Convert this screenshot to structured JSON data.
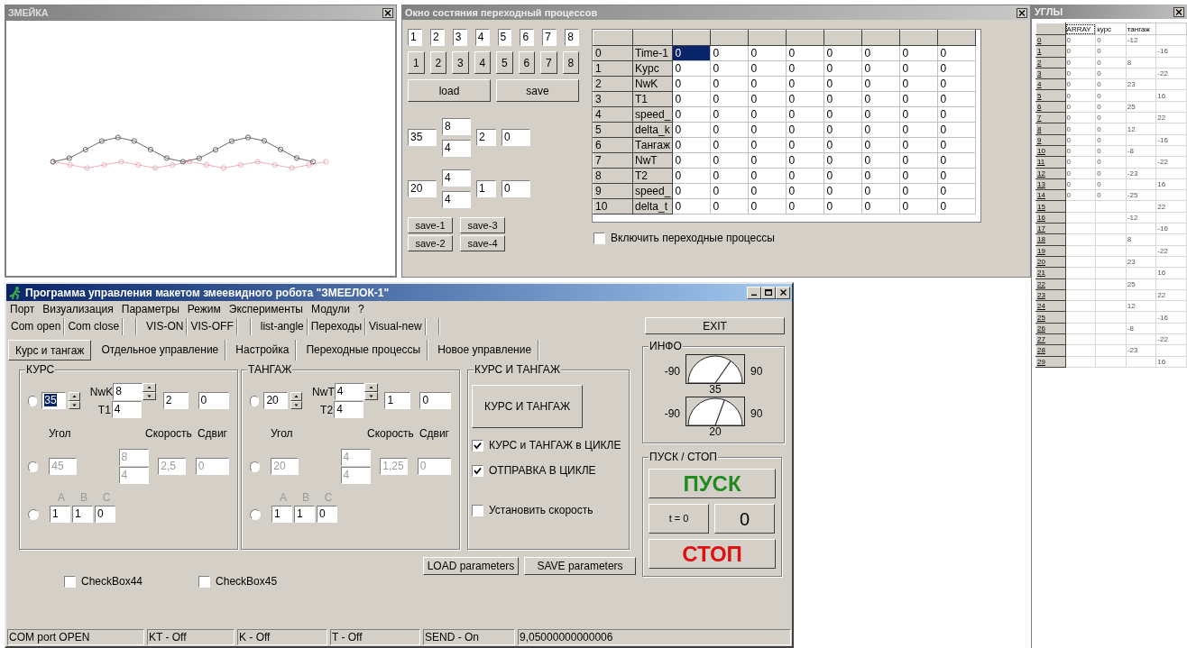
{
  "graph_window": {
    "title": "ЗМЕЙКА"
  },
  "transition_window": {
    "title": "Окно состяния переходный процессов",
    "index_fields": [
      "1",
      "2",
      "3",
      "4",
      "5",
      "6",
      "7",
      "8"
    ],
    "index_buttons": [
      "1",
      "2",
      "3",
      "4",
      "5",
      "6",
      "7",
      "8"
    ],
    "file_buttons": [
      "load",
      "save"
    ],
    "parameter_sets": [
      {
        "angle": "35",
        "nw": "8",
        "t": "4",
        "speed": "2",
        "shift": "0"
      },
      {
        "angle": "20",
        "nw": "4",
        "t": "4",
        "speed": "1",
        "shift": "0"
      }
    ],
    "save_buttons": [
      "save-1",
      "save-3",
      "save-2",
      "save-4"
    ],
    "table": {
      "rows": [
        {
          "index": "0",
          "name": "Time-1",
          "cells": [
            {
              "value": "0",
              "selected": true
            },
            {
              "value": "0",
              "selected": false
            },
            {
              "value": "0",
              "selected": false
            },
            {
              "value": "0",
              "selected": false
            },
            {
              "value": "0",
              "selected": false
            },
            {
              "value": "0",
              "selected": false
            },
            {
              "value": "0",
              "selected": false
            },
            {
              "value": "0",
              "selected": false
            }
          ]
        },
        {
          "index": "1",
          "name": "Kypc",
          "cells": [
            {
              "value": "0",
              "selected": false
            },
            {
              "value": "0",
              "selected": false
            },
            {
              "value": "0",
              "selected": false
            },
            {
              "value": "0",
              "selected": false
            },
            {
              "value": "0",
              "selected": false
            },
            {
              "value": "0",
              "selected": false
            },
            {
              "value": "0",
              "selected": false
            },
            {
              "value": "0",
              "selected": false
            }
          ]
        },
        {
          "index": "2",
          "name": "NwK",
          "cells": [
            {
              "value": "0",
              "selected": false
            },
            {
              "value": "0",
              "selected": false
            },
            {
              "value": "0",
              "selected": false
            },
            {
              "value": "0",
              "selected": false
            },
            {
              "value": "0",
              "selected": false
            },
            {
              "value": "0",
              "selected": false
            },
            {
              "value": "0",
              "selected": false
            },
            {
              "value": "0",
              "selected": false
            }
          ]
        },
        {
          "index": "3",
          "name": "T1",
          "cells": [
            {
              "value": "0",
              "selected": false
            },
            {
              "value": "0",
              "selected": false
            },
            {
              "value": "0",
              "selected": false
            },
            {
              "value": "0",
              "selected": false
            },
            {
              "value": "0",
              "selected": false
            },
            {
              "value": "0",
              "selected": false
            },
            {
              "value": "0",
              "selected": false
            },
            {
              "value": "0",
              "selected": false
            }
          ]
        },
        {
          "index": "4",
          "name": "speed_",
          "cells": [
            {
              "value": "0",
              "selected": false
            },
            {
              "value": "0",
              "selected": false
            },
            {
              "value": "0",
              "selected": false
            },
            {
              "value": "0",
              "selected": false
            },
            {
              "value": "0",
              "selected": false
            },
            {
              "value": "0",
              "selected": false
            },
            {
              "value": "0",
              "selected": false
            },
            {
              "value": "0",
              "selected": false
            }
          ]
        },
        {
          "index": "5",
          "name": "delta_k",
          "cells": [
            {
              "value": "0",
              "selected": false
            },
            {
              "value": "0",
              "selected": false
            },
            {
              "value": "0",
              "selected": false
            },
            {
              "value": "0",
              "selected": false
            },
            {
              "value": "0",
              "selected": false
            },
            {
              "value": "0",
              "selected": false
            },
            {
              "value": "0",
              "selected": false
            },
            {
              "value": "0",
              "selected": false
            }
          ]
        },
        {
          "index": "6",
          "name": "Тангаж",
          "cells": [
            {
              "value": "0",
              "selected": false
            },
            {
              "value": "0",
              "selected": false
            },
            {
              "value": "0",
              "selected": false
            },
            {
              "value": "0",
              "selected": false
            },
            {
              "value": "0",
              "selected": false
            },
            {
              "value": "0",
              "selected": false
            },
            {
              "value": "0",
              "selected": false
            },
            {
              "value": "0",
              "selected": false
            }
          ]
        },
        {
          "index": "7",
          "name": "NwT",
          "cells": [
            {
              "value": "0",
              "selected": false
            },
            {
              "value": "0",
              "selected": false
            },
            {
              "value": "0",
              "selected": false
            },
            {
              "value": "0",
              "selected": false
            },
            {
              "value": "0",
              "selected": false
            },
            {
              "value": "0",
              "selected": false
            },
            {
              "value": "0",
              "selected": false
            },
            {
              "value": "0",
              "selected": false
            }
          ]
        },
        {
          "index": "8",
          "name": "T2",
          "cells": [
            {
              "value": "0",
              "selected": false
            },
            {
              "value": "0",
              "selected": false
            },
            {
              "value": "0",
              "selected": false
            },
            {
              "value": "0",
              "selected": false
            },
            {
              "value": "0",
              "selected": false
            },
            {
              "value": "0",
              "selected": false
            },
            {
              "value": "0",
              "selected": false
            },
            {
              "value": "0",
              "selected": false
            }
          ]
        },
        {
          "index": "9",
          "name": "speed_",
          "cells": [
            {
              "value": "0",
              "selected": false
            },
            {
              "value": "0",
              "selected": false
            },
            {
              "value": "0",
              "selected": false
            },
            {
              "value": "0",
              "selected": false
            },
            {
              "value": "0",
              "selected": false
            },
            {
              "value": "0",
              "selected": false
            },
            {
              "value": "0",
              "selected": false
            },
            {
              "value": "0",
              "selected": false
            }
          ]
        },
        {
          "index": "10",
          "name": "delta_t",
          "cells": [
            {
              "value": "0",
              "selected": false
            },
            {
              "value": "0",
              "selected": false
            },
            {
              "value": "0",
              "selected": false
            },
            {
              "value": "0",
              "selected": false
            },
            {
              "value": "0",
              "selected": false
            },
            {
              "value": "0",
              "selected": false
            },
            {
              "value": "0",
              "selected": false
            },
            {
              "value": "0",
              "selected": false
            }
          ]
        }
      ]
    },
    "enable_checkbox": {
      "label": "Включить переходные процессы",
      "checked": false
    }
  },
  "angles_window": {
    "title": "УГЛЫ",
    "columns": [
      "ARRAY",
      "курс",
      "тангаж"
    ],
    "rows": [
      {
        "index": "0",
        "array": "0",
        "kurs": "0",
        "tangazh": "-12"
      },
      {
        "index": "1",
        "array": "0",
        "kurs": "0",
        "column_4": "-16"
      },
      {
        "index": "2",
        "array": "0",
        "kurs": "0",
        "tangazh": "8"
      },
      {
        "index": "3",
        "array": "0",
        "kurs": "0",
        "column_4": "-22"
      },
      {
        "index": "4",
        "array": "0",
        "kurs": "0",
        "tangazh": "23"
      },
      {
        "index": "5",
        "array": "0",
        "kurs": "0",
        "column_4": "16"
      },
      {
        "index": "6",
        "array": "0",
        "kurs": "0",
        "tangazh": "25"
      },
      {
        "index": "7",
        "array": "0",
        "kurs": "0",
        "column_4": "22"
      },
      {
        "index": "8",
        "array": "0",
        "kurs": "0",
        "tangazh": "12"
      },
      {
        "index": "9",
        "array": "0",
        "kurs": "0",
        "column_4": "-16"
      },
      {
        "index": "10",
        "array": "0",
        "kurs": "0",
        "tangazh": "-8"
      },
      {
        "index": "11",
        "array": "0",
        "kurs": "0",
        "column_4": "-22"
      },
      {
        "index": "12",
        "array": "0",
        "kurs": "0",
        "tangazh": "-23"
      },
      {
        "index": "13",
        "array": "0",
        "kurs": "0",
        "column_4": "16"
      },
      {
        "index": "14",
        "array": "0",
        "kurs": "0",
        "tangazh": "-25"
      },
      {
        "index": "15",
        "column_4": "22"
      },
      {
        "index": "16",
        "tangazh": "-12"
      },
      {
        "index": "17",
        "column_4": "-16"
      },
      {
        "index": "18",
        "tangazh": "8"
      },
      {
        "index": "19",
        "column_4": "-22"
      },
      {
        "index": "20",
        "tangazh": "23"
      },
      {
        "index": "21",
        "column_4": "16"
      },
      {
        "index": "22",
        "tangazh": "25"
      },
      {
        "index": "23",
        "column_4": "22"
      },
      {
        "index": "24",
        "tangazh": "12"
      },
      {
        "index": "25",
        "column_4": "-16"
      },
      {
        "index": "26",
        "tangazh": "-8"
      },
      {
        "index": "27",
        "column_4": "-22"
      },
      {
        "index": "28",
        "tangazh": "-23"
      },
      {
        "index": "29",
        "column_4": "16"
      }
    ]
  },
  "main_window": {
    "title": "Программа управления макетом змеевидного робота \"ЗМЕЕЛОК-1\"",
    "menu": [
      "Порт",
      "Визуализация",
      "Параметры",
      "Режим",
      "Эксперименты",
      "Модули",
      "?"
    ],
    "toolbar": [
      {
        "kind": "button",
        "label": "Com open"
      },
      {
        "kind": "button",
        "label": "Com close"
      },
      {
        "kind": "spacer"
      },
      {
        "kind": "button",
        "label": "VIS-ON"
      },
      {
        "kind": "button",
        "label": "VIS-OFF"
      },
      {
        "kind": "spacer"
      },
      {
        "kind": "button",
        "label": "list-angle"
      },
      {
        "kind": "button",
        "label": "Переходы"
      },
      {
        "kind": "button",
        "label": "Visual-new"
      },
      {
        "kind": "spacer"
      }
    ],
    "exit_button": "EXIT",
    "tabs": [
      {
        "label": "Курс и тангаж",
        "selected": true
      },
      {
        "label": "Отдельное управление",
        "selected": false
      },
      {
        "label": "Настройка",
        "selected": false
      },
      {
        "label": "Переходные процессы",
        "selected": false
      },
      {
        "label": "Новое управление",
        "selected": false
      }
    ],
    "groups": [
      {
        "title": "КУРС",
        "angle": "35",
        "angle_focused": true,
        "nw_label": "NwK",
        "nw": "8",
        "t_label": "T1",
        "t": "4",
        "speed": "2",
        "shift": "0",
        "angle_label": "Угол",
        "speed_label": "Скорость",
        "shift_label": "Сдвиг",
        "radios": [
          {
            "selected": false
          },
          {
            "selected": false
          },
          {
            "selected": false
          }
        ],
        "preset": {
          "angle": "45",
          "nw": "8",
          "t": "4",
          "speed": "2,5",
          "shift": "0",
          "disabled": true
        },
        "abc_labels": [
          "A",
          "B",
          "C"
        ],
        "abc": [
          "1",
          "1",
          "0"
        ]
      },
      {
        "title": "ТАНГАЖ",
        "angle": "20",
        "angle_focused": false,
        "nw_label": "NwT",
        "nw": "4",
        "t_label": "T2",
        "t": "4",
        "speed": "1",
        "shift": "0",
        "angle_label": "Угол",
        "speed_label": "Скорость",
        "shift_label": "Сдвиг",
        "radios": [
          {
            "selected": false
          },
          {
            "selected": false
          },
          {
            "selected": false
          }
        ],
        "preset": {
          "angle": "20",
          "nw": "4",
          "t": "4",
          "speed": "1,25",
          "shift": "0",
          "disabled": true
        },
        "abc_labels": [
          "A",
          "B",
          "C"
        ],
        "abc": [
          "1",
          "1",
          "0"
        ]
      }
    ],
    "combined_group": {
      "title": "КУРС И ТАНГАЖ",
      "button": "КУРС И ТАНГАЖ",
      "checkboxes": [
        {
          "label": "КУРС и ТАНГАЖ в ЦИКЛЕ",
          "checked": true
        },
        {
          "label": "ОТПРАВКА В ЦИКЛЕ",
          "checked": true
        },
        {
          "label": "Установить скорость",
          "checked": false
        }
      ]
    },
    "info_group": {
      "title": "ИНФО",
      "gauges": [
        {
          "min": "-90",
          "max": "90",
          "value": "35"
        },
        {
          "min": "-90",
          "max": "90",
          "value": "20"
        }
      ]
    },
    "start_stop_group": {
      "title": "ПУСК / СТОП",
      "start": "ПУСК",
      "reset": "t = 0",
      "counter": "0",
      "stop": "СТОП"
    },
    "param_buttons": [
      "LOAD parameters",
      "SAVE parameters"
    ],
    "checkboxes": [
      {
        "label": "CheckBox44",
        "checked": false
      },
      {
        "label": "CheckBox45",
        "checked": false
      }
    ],
    "status_bar": [
      "COM port OPEN",
      "KT - Off",
      "K - Off",
      "T - Off",
      "SEND - On",
      "9,05000000000006"
    ]
  }
}
